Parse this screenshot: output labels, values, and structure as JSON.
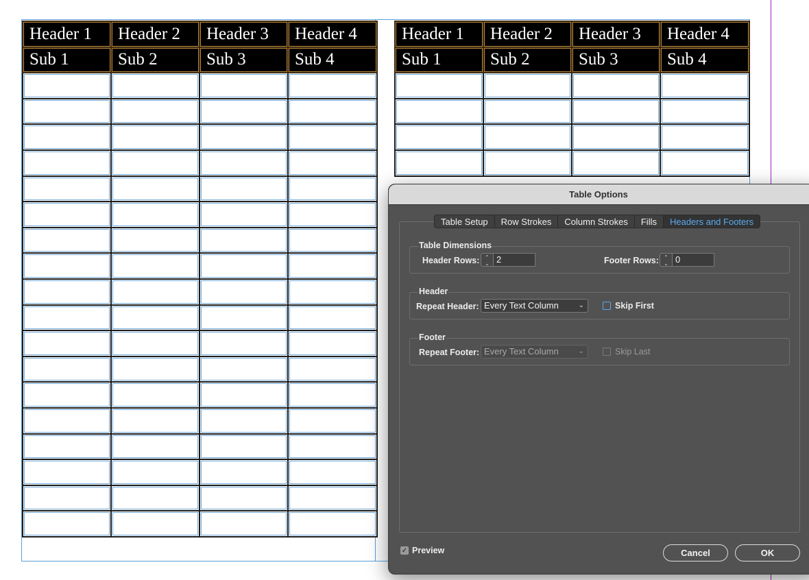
{
  "left_table": {
    "header_row_1": [
      "Header 1",
      "Header 2",
      "Header 3",
      "Header 4"
    ],
    "header_row_2": [
      "Sub 1",
      "Sub 2",
      "Sub 3",
      "Sub 4"
    ],
    "body_rows": 18
  },
  "right_table": {
    "header_row_1": [
      "Header 1",
      "Header 2",
      "Header 3",
      "Header 4"
    ],
    "header_row_2": [
      "Sub 1",
      "Sub 2",
      "Sub 3",
      "Sub 4"
    ],
    "body_rows": 4
  },
  "dialog": {
    "title": "Table Options",
    "tabs": [
      {
        "label": "Table Setup",
        "active": false
      },
      {
        "label": "Row Strokes",
        "active": false
      },
      {
        "label": "Column Strokes",
        "active": false
      },
      {
        "label": "Fills",
        "active": false
      },
      {
        "label": "Headers and Footers",
        "active": true
      }
    ],
    "table_dimensions": {
      "title": "Table Dimensions",
      "header_rows_label": "Header Rows:",
      "header_rows_value": "2",
      "footer_rows_label": "Footer Rows:",
      "footer_rows_value": "0"
    },
    "header": {
      "title": "Header",
      "repeat_label": "Repeat Header:",
      "repeat_value": "Every Text Column",
      "skip_label": "Skip First",
      "skip_checked": false
    },
    "footer": {
      "title": "Footer",
      "repeat_label": "Repeat Footer:",
      "repeat_value": "Every Text Column",
      "skip_label": "Skip Last",
      "skip_checked": false,
      "disabled": true
    },
    "preview_label": "Preview",
    "preview_checked": true,
    "cancel_label": "Cancel",
    "ok_label": "OK",
    "accent_color": "#5aa9f0"
  }
}
